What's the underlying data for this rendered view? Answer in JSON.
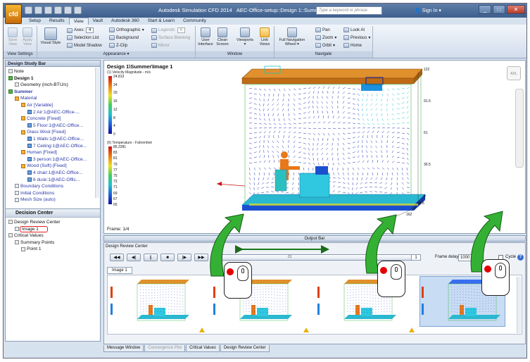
{
  "window": {
    "app_title": "Autodesk Simulation CFD 2014",
    "doc_title": "AEC-Office-setup::Design 1::Summer",
    "search_placeholder": "Type a keyword or phrase",
    "sign_in": "Sign In",
    "logo_text": "cfd",
    "minimize": "_",
    "maximize": "□",
    "close": "✕"
  },
  "ribbon_tabs": [
    "Setup",
    "Results",
    "View",
    "Vault",
    "Autodesk 360",
    "Start & Learn",
    "Community"
  ],
  "ribbon": {
    "view_settings": {
      "label": "View Settings",
      "save_view": "Save View",
      "apply_view": "Apply View"
    },
    "appearance": {
      "label": "Appearance",
      "visual_style": "Visual Style",
      "axes": "Axes:",
      "axes_value": "4",
      "orthographic": "Orthographic",
      "legends": "Legends:",
      "legends_value": "6",
      "selection_list": "Selection List",
      "background": "Background",
      "surface_blanking": "Surface Blanking",
      "model_shadow": "Model Shadow",
      "z_clip": "Z-Clip",
      "mirror": "Mirror"
    },
    "window": {
      "label": "Window",
      "user_interface": "User Interface",
      "clean_screen": "Clean Screen",
      "viewports": "Viewports",
      "link_views": "Link Views"
    },
    "navigate": {
      "label": "Navigate",
      "full_nav_wheel": "Full Navigation Wheel",
      "pan": "Pan",
      "zoom": "Zoom",
      "orbit": "Orbit",
      "look_at": "Look At",
      "previous": "Previous",
      "home": "Home"
    }
  },
  "design_study_bar": {
    "title": "Design Study Bar",
    "items": [
      {
        "label": "Note",
        "indent": 0,
        "style": "",
        "icon": "note-icon"
      },
      {
        "label": "Design 1",
        "indent": 0,
        "style": "tb",
        "icon": "design-icon"
      },
      {
        "label": "Geometry (inch-BTU/s)",
        "indent": 1,
        "style": "",
        "icon": "geometry-icon"
      },
      {
        "label": "Summer",
        "indent": 0,
        "style": "tb tg",
        "icon": "scenario-icon"
      },
      {
        "label": "Material",
        "indent": 1,
        "style": "tg",
        "icon": "material-icon"
      },
      {
        "label": "Air [Variable]",
        "indent": 2,
        "style": "tg",
        "icon": "material-icon"
      },
      {
        "label": "2 Air:1@AEC-Office-...",
        "indent": 3,
        "style": "tg",
        "icon": "part-icon"
      },
      {
        "label": "Concrete [Fixed]",
        "indent": 2,
        "style": "tg",
        "icon": "material-icon"
      },
      {
        "label": "5 Floor:1@AEC-Office...",
        "indent": 3,
        "style": "tg",
        "icon": "part-icon"
      },
      {
        "label": "Glass Wool [Fixed]",
        "indent": 2,
        "style": "tg",
        "icon": "material-icon"
      },
      {
        "label": "1 Walls:1@AEC-Office...",
        "indent": 3,
        "style": "tg",
        "icon": "part-icon"
      },
      {
        "label": "7 Ceiling:1@AEC-Office...",
        "indent": 3,
        "style": "tg",
        "icon": "part-icon"
      },
      {
        "label": "Human [Fixed]",
        "indent": 2,
        "style": "tg",
        "icon": "material-icon"
      },
      {
        "label": "3 person:1@AEC-Office...",
        "indent": 3,
        "style": "tg",
        "icon": "part-icon"
      },
      {
        "label": "Wood (Soft) [Fixed]",
        "indent": 2,
        "style": "tg",
        "icon": "material-icon"
      },
      {
        "label": "4 chair:1@AEC-Office...",
        "indent": 3,
        "style": "tg",
        "icon": "part-icon"
      },
      {
        "label": "6 dusk:1@AEC-Offic...",
        "indent": 3,
        "style": "tg",
        "icon": "part-icon"
      },
      {
        "label": "Boundary Conditions",
        "indent": 1,
        "style": "tg",
        "icon": "bc-icon"
      },
      {
        "label": "Initial Conditions",
        "indent": 1,
        "style": "tg",
        "icon": "ic-icon"
      },
      {
        "label": "Mesh Size (auto)",
        "indent": 1,
        "style": "tg",
        "icon": "mesh-icon"
      }
    ]
  },
  "decision_center": {
    "title": "Decision Center",
    "items": [
      {
        "label": "Design Review Center",
        "indent": 0,
        "icon": "review-icon"
      },
      {
        "label": "Image 1",
        "indent": 1,
        "icon": "image-icon",
        "highlight": true
      },
      {
        "label": "Critical Values",
        "indent": 0,
        "icon": "critical-icon"
      },
      {
        "label": "Summary Points",
        "indent": 1,
        "icon": "summary-icon"
      },
      {
        "label": "Point 1",
        "indent": 2,
        "icon": "point-icon"
      }
    ]
  },
  "viewport": {
    "title": "Design 1\\Summer\\Image 1",
    "legend1": {
      "label": "(1) Velocity Magnitude - m/s",
      "ticks": [
        "24.813",
        "24",
        "20",
        "16",
        "12",
        "8",
        "4",
        "0"
      ]
    },
    "legend2": {
      "label": "(6) Temperature - Fahrenheit",
      "ticks": [
        "85.2281",
        "83",
        "81",
        "79",
        "77",
        "75",
        "73",
        "71",
        "69",
        "67",
        "65"
      ]
    },
    "ruler_right": [
      "122",
      "91.5",
      "61",
      "30.5",
      "0"
    ],
    "ruler_bottom": [
      "48.5",
      "97",
      "162"
    ],
    "frame": "Frame: 1/4",
    "navcube": "ADL"
  },
  "output_bar": "Output Bar",
  "review_center": {
    "title": "Design Review Center",
    "buttons": [
      "◀◀",
      "◀|",
      "||",
      "■",
      "|▶",
      "▶▶"
    ],
    "slider_label": "01",
    "frame_index": "1",
    "frame_delay_label": "Frame delay:",
    "frame_delay": "1000",
    "ms": "ms",
    "cycle": "Cycle",
    "help": "?",
    "image_tab": "Image 1"
  },
  "bottom_tabs": [
    "Message Window",
    "Convergence Plot",
    "Critical Values",
    "Design Review Center"
  ],
  "colors": {
    "accent": "#2a39a8",
    "arrow": "#2aa02a",
    "highlight": "#e02020"
  }
}
